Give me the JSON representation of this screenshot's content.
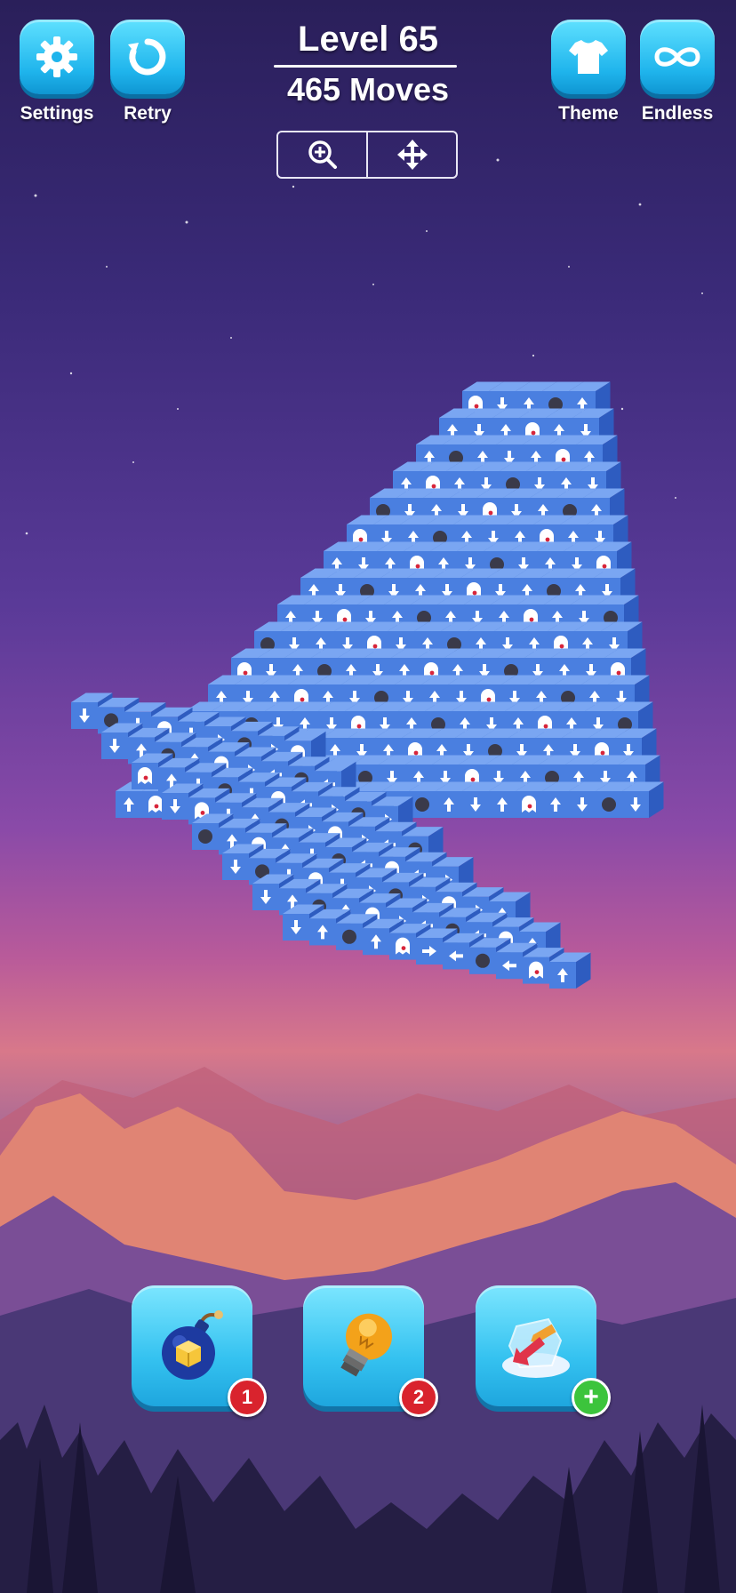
{
  "header": {
    "level_text": "Level 65",
    "moves_text": "465 Moves"
  },
  "top_left_buttons": [
    {
      "label": "Settings",
      "icon": "gear-icon"
    },
    {
      "label": "Retry",
      "icon": "retry-icon"
    }
  ],
  "top_right_buttons": [
    {
      "label": "Theme",
      "icon": "shirt-icon"
    },
    {
      "label": "Endless",
      "icon": "infinity-icon"
    }
  ],
  "view_tools": [
    {
      "icon": "zoom-in-icon"
    },
    {
      "icon": "move-arrows-icon"
    }
  ],
  "powerups": [
    {
      "icon": "bomb-icon",
      "badge": "1",
      "badge_color": "#d9232d"
    },
    {
      "icon": "lightbulb-hint-icon",
      "badge": "2",
      "badge_color": "#d9232d"
    },
    {
      "icon": "undo-arrows-icon",
      "badge": "+",
      "badge_color": "#3cc43c"
    }
  ],
  "colors": {
    "button_blue": "#1fb4ec",
    "cube_blue": "#4a7fe0"
  }
}
